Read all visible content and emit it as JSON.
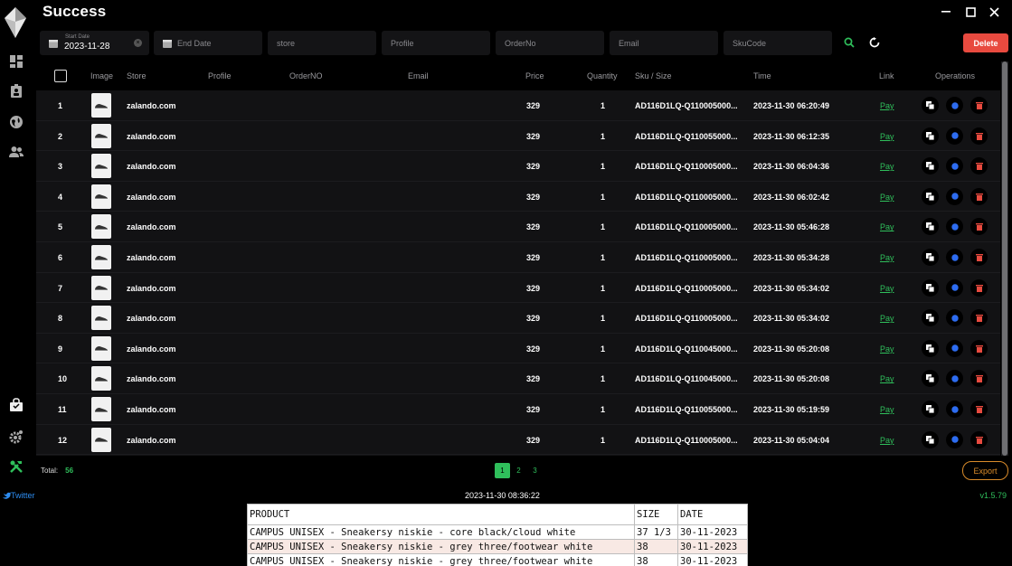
{
  "app": {
    "title": "Success"
  },
  "sidebar": {
    "items": [
      {
        "name": "dashboard-icon"
      },
      {
        "name": "profiles-icon"
      },
      {
        "name": "proxy-globe-icon"
      },
      {
        "name": "accounts-icon"
      },
      {
        "name": "shop-bag-icon"
      },
      {
        "name": "settings-icon"
      },
      {
        "name": "tools-icon"
      }
    ]
  },
  "filters": {
    "start_date_label": "Start Date",
    "start_date_value": "2023-11-28",
    "end_date_placeholder": "End Date",
    "store_placeholder": "store",
    "profile_placeholder": "Profile",
    "orderno_placeholder": "OrderNo",
    "email_placeholder": "Email",
    "skucode_placeholder": "SkuCode"
  },
  "toolbar": {
    "delete_label": "Delete"
  },
  "table": {
    "headers": {
      "image": "Image",
      "store": "Store",
      "profile": "Profile",
      "orderno": "OrderNO",
      "email": "Email",
      "price": "Price",
      "quantity": "Quantity",
      "sku": "Sku / Size",
      "time": "Time",
      "link": "Link",
      "operations": "Operations"
    },
    "rows": [
      {
        "num": "1",
        "store": "zalando.com",
        "price": "329",
        "qty": "1",
        "sku": "AD116D1LQ-Q110005000...",
        "time": "2023-11-30 06:20:49",
        "link": "Pay"
      },
      {
        "num": "2",
        "store": "zalando.com",
        "price": "329",
        "qty": "1",
        "sku": "AD116D1LQ-Q110055000...",
        "time": "2023-11-30 06:12:35",
        "link": "Pay"
      },
      {
        "num": "3",
        "store": "zalando.com",
        "price": "329",
        "qty": "1",
        "sku": "AD116D1LQ-Q110005000...",
        "time": "2023-11-30 06:04:36",
        "link": "Pay"
      },
      {
        "num": "4",
        "store": "zalando.com",
        "price": "329",
        "qty": "1",
        "sku": "AD116D1LQ-Q110005000...",
        "time": "2023-11-30 06:02:42",
        "link": "Pay"
      },
      {
        "num": "5",
        "store": "zalando.com",
        "price": "329",
        "qty": "1",
        "sku": "AD116D1LQ-Q110005000...",
        "time": "2023-11-30 05:46:28",
        "link": "Pay"
      },
      {
        "num": "6",
        "store": "zalando.com",
        "price": "329",
        "qty": "1",
        "sku": "AD116D1LQ-Q110005000...",
        "time": "2023-11-30 05:34:28",
        "link": "Pay"
      },
      {
        "num": "7",
        "store": "zalando.com",
        "price": "329",
        "qty": "1",
        "sku": "AD116D1LQ-Q110005000...",
        "time": "2023-11-30 05:34:02",
        "link": "Pay"
      },
      {
        "num": "8",
        "store": "zalando.com",
        "price": "329",
        "qty": "1",
        "sku": "AD116D1LQ-Q110005000...",
        "time": "2023-11-30 05:34:02",
        "link": "Pay"
      },
      {
        "num": "9",
        "store": "zalando.com",
        "price": "329",
        "qty": "1",
        "sku": "AD116D1LQ-Q110045000...",
        "time": "2023-11-30 05:20:08",
        "link": "Pay"
      },
      {
        "num": "10",
        "store": "zalando.com",
        "price": "329",
        "qty": "1",
        "sku": "AD116D1LQ-Q110045000...",
        "time": "2023-11-30 05:20:08",
        "link": "Pay"
      },
      {
        "num": "11",
        "store": "zalando.com",
        "price": "329",
        "qty": "1",
        "sku": "AD116D1LQ-Q110055000...",
        "time": "2023-11-30 05:19:59",
        "link": "Pay"
      },
      {
        "num": "12",
        "store": "zalando.com",
        "price": "329",
        "qty": "1",
        "sku": "AD116D1LQ-Q110005000...",
        "time": "2023-11-30 05:04:04",
        "link": "Pay"
      }
    ]
  },
  "footer": {
    "total_label": "Total:",
    "total_value": "56",
    "pages": [
      "1",
      "2",
      "3"
    ],
    "active_page": "1",
    "export_label": "Export"
  },
  "statusbar": {
    "twitter_label": "Twitter",
    "clock": "2023-11-30 08:36:22",
    "version": "v1.5.79"
  },
  "products": {
    "headers": [
      "PRODUCT",
      "SIZE",
      "DATE"
    ],
    "rows": [
      [
        "CAMPUS UNISEX - Sneakersy niskie - core black/cloud white",
        "37 1/3",
        "30-11-2023"
      ],
      [
        "CAMPUS UNISEX - Sneakersy niskie - grey three/footwear white",
        "38",
        "30-11-2023"
      ],
      [
        "CAMPUS UNISEX - Sneakersy niskie - grey three/footwear white",
        "38",
        "30-11-2023"
      ]
    ]
  },
  "colors": {
    "accent_green": "#2fbf5b",
    "delete_red": "#e84a3f",
    "export_orange": "#d98b2a",
    "twitter_blue": "#2d8cf0"
  }
}
